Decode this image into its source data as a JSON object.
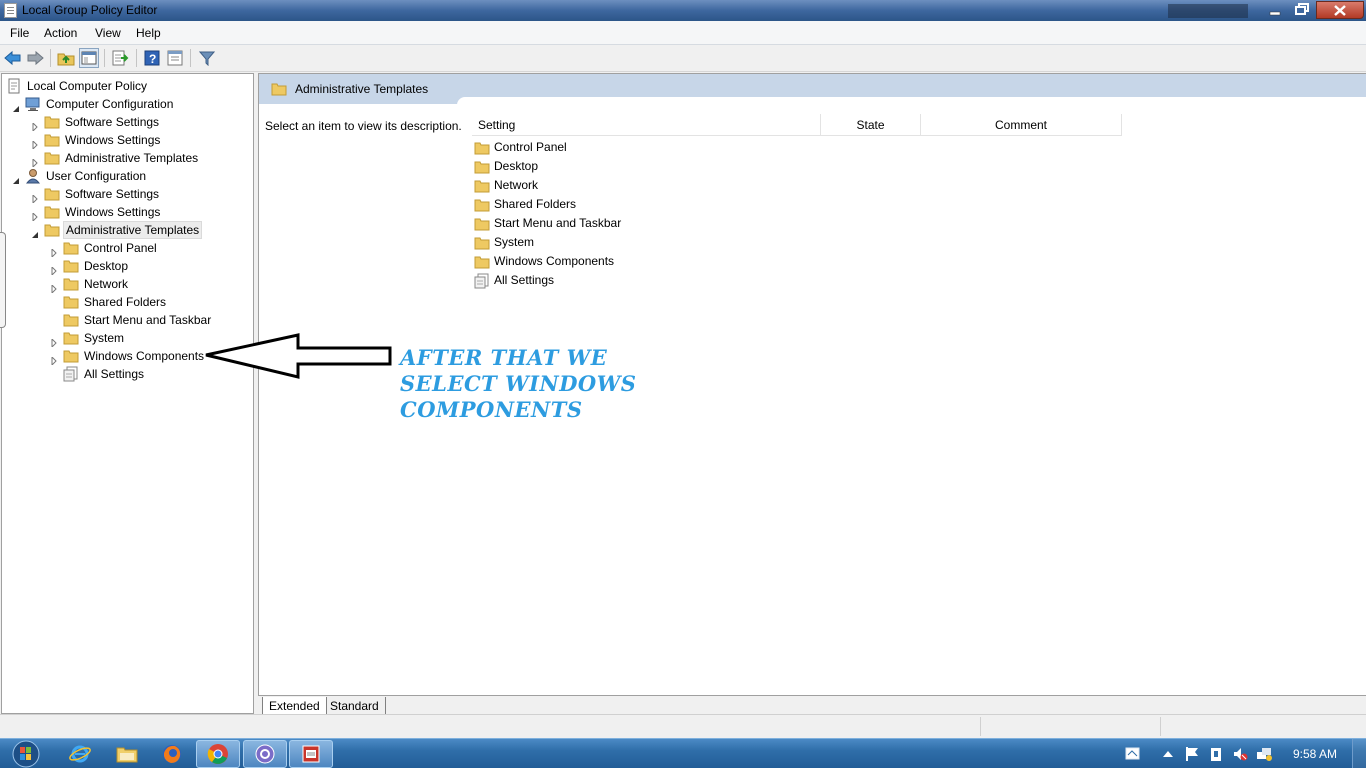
{
  "window": {
    "title": "Local Group Policy Editor"
  },
  "menubar": {
    "items": [
      "File",
      "Action",
      "View",
      "Help"
    ]
  },
  "toolbar": {
    "icons": [
      "back-icon",
      "forward-icon",
      "up-folder-icon",
      "show-hide-tree-icon",
      "export-list-icon",
      "help-icon",
      "properties-icon",
      "filter-icon"
    ]
  },
  "tree": {
    "root": "Local Computer Policy",
    "computer_config": "Computer Configuration",
    "cc_software": "Software Settings",
    "cc_windows": "Windows Settings",
    "cc_admin": "Administrative Templates",
    "user_config": "User Configuration",
    "uc_software": "Software Settings",
    "uc_windows": "Windows Settings",
    "uc_admin": "Administrative Templates",
    "uc_admin_children": [
      "Control Panel",
      "Desktop",
      "Network",
      "Shared Folders",
      "Start Menu and Taskbar",
      "System",
      "Windows Components",
      "All Settings"
    ]
  },
  "right_pane": {
    "header": "Administrative Templates",
    "description": "Select an item to view its description.",
    "columns": {
      "setting": "Setting",
      "state": "State",
      "comment": "Comment"
    },
    "items": [
      "Control Panel",
      "Desktop",
      "Network",
      "Shared Folders",
      "Start Menu and Taskbar",
      "System",
      "Windows Components",
      "All Settings"
    ]
  },
  "tabs": {
    "extended": "Extended",
    "standard": "Standard"
  },
  "annotation": {
    "text": "AFTER THAT WE SELECT WINDOWS COMPONENTS",
    "color": "#2d9ce0"
  },
  "taskbar": {
    "apps": [
      "start-orb-icon",
      "internet-explorer-icon",
      "file-explorer-icon",
      "firefox-icon",
      "chrome-icon",
      "app-icon",
      "group-policy-icon"
    ],
    "clock": "9:58 AM"
  }
}
